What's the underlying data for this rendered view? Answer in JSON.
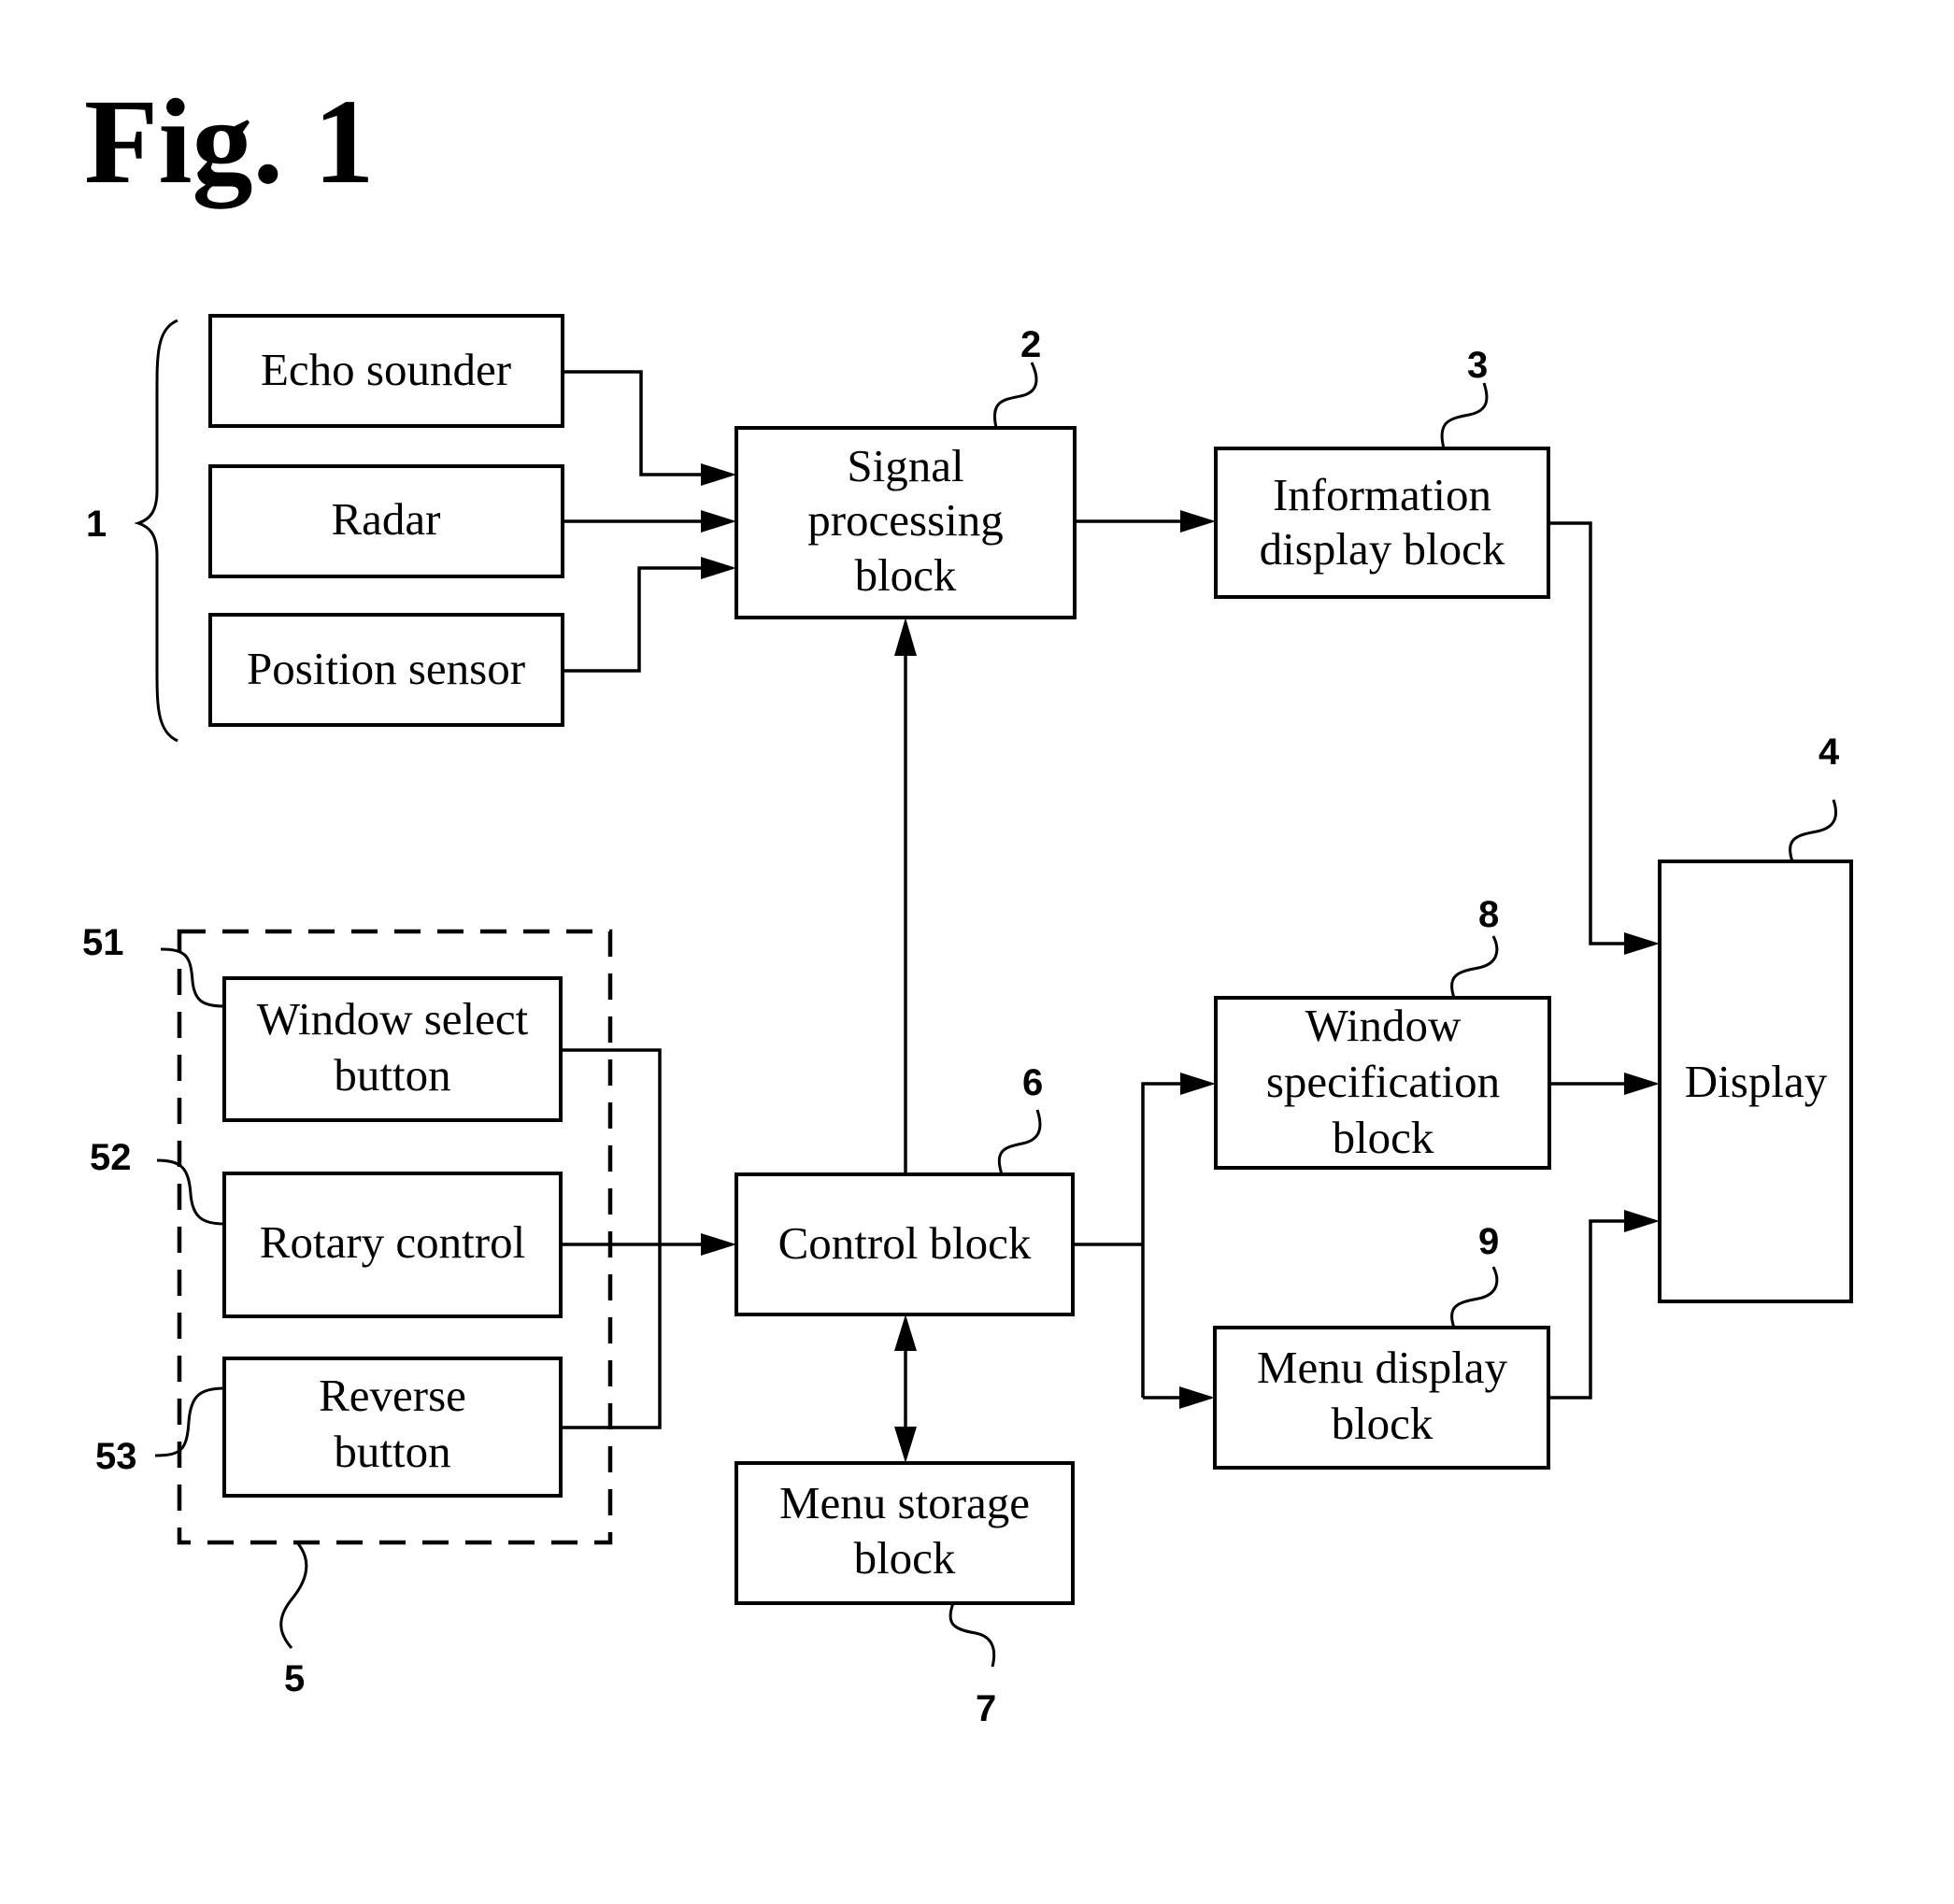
{
  "figure": {
    "title": "Fig. 1"
  },
  "blocks": {
    "echo_sounder": {
      "ref": "",
      "lines": [
        "Echo sounder"
      ]
    },
    "radar": {
      "ref": "",
      "lines": [
        "Radar"
      ]
    },
    "position_sensor": {
      "ref": "",
      "lines": [
        "Position sensor"
      ]
    },
    "signal_processing": {
      "ref": "2",
      "lines": [
        "Signal",
        "processing",
        "block"
      ]
    },
    "information_display": {
      "ref": "3",
      "lines": [
        "Information",
        "display block"
      ]
    },
    "display": {
      "ref": "4",
      "lines": [
        "Display"
      ]
    },
    "window_select_button": {
      "ref": "51",
      "lines": [
        "Window select",
        "button"
      ]
    },
    "rotary_control": {
      "ref": "52",
      "lines": [
        "Rotary control"
      ]
    },
    "reverse_button": {
      "ref": "53",
      "lines": [
        "Reverse",
        "button"
      ]
    },
    "control": {
      "ref": "6",
      "lines": [
        "Control block"
      ]
    },
    "menu_storage": {
      "ref": "7",
      "lines": [
        "Menu storage",
        "block"
      ]
    },
    "window_specification": {
      "ref": "8",
      "lines": [
        "Window",
        "specification",
        "block"
      ]
    },
    "menu_display": {
      "ref": "9",
      "lines": [
        "Menu display",
        "block"
      ]
    }
  },
  "groups": {
    "sensors": {
      "ref": "1"
    },
    "operation_unit": {
      "ref": "5"
    }
  },
  "connections": [
    {
      "from": "echo_sounder",
      "to": "signal_processing",
      "type": "arrow"
    },
    {
      "from": "radar",
      "to": "signal_processing",
      "type": "arrow"
    },
    {
      "from": "position_sensor",
      "to": "signal_processing",
      "type": "arrow"
    },
    {
      "from": "signal_processing",
      "to": "information_display",
      "type": "arrow"
    },
    {
      "from": "information_display",
      "to": "display",
      "type": "arrow"
    },
    {
      "from": "window_select_button",
      "to": "control",
      "type": "arrow"
    },
    {
      "from": "rotary_control",
      "to": "control",
      "type": "arrow"
    },
    {
      "from": "reverse_button",
      "to": "control",
      "type": "arrow"
    },
    {
      "from": "control",
      "to": "signal_processing",
      "type": "arrow"
    },
    {
      "from": "control",
      "to": "menu_storage",
      "type": "bidirectional"
    },
    {
      "from": "control",
      "to": "window_specification",
      "type": "arrow"
    },
    {
      "from": "control",
      "to": "menu_display",
      "type": "arrow"
    },
    {
      "from": "window_specification",
      "to": "display",
      "type": "arrow"
    },
    {
      "from": "menu_display",
      "to": "display",
      "type": "arrow"
    }
  ]
}
